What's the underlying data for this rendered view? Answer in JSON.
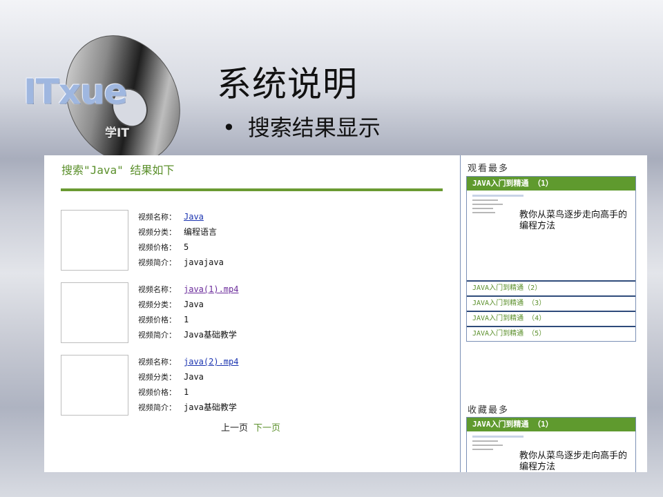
{
  "logo": {
    "text": "ITxue",
    "sub": "学IT"
  },
  "slide": {
    "title": "系统说明",
    "bullet": "搜索结果显示",
    "bullet_dot": "•"
  },
  "search": {
    "heading": "搜索\"Java\" 结果如下"
  },
  "labels": {
    "name": "视频名称：",
    "category": "视频分类：",
    "price": "视频价格：",
    "intro": "视频简介："
  },
  "results": [
    {
      "name": "Java",
      "category": "编程语言",
      "price": "5",
      "intro": "javajava"
    },
    {
      "name": "java(1).mp4",
      "category": "Java",
      "price": "1",
      "intro": "Java基础教学"
    },
    {
      "name": "java(2).mp4",
      "category": "Java",
      "price": "1",
      "intro": "java基础教学"
    }
  ],
  "pager": {
    "prev": "上一页",
    "next": "下一页"
  },
  "sidebar": {
    "most_viewed": {
      "title": "观看最多",
      "featured": "JAVA入门到精通 （1）",
      "featured_desc": "教你从菜鸟逐步走向高手的编程方法",
      "items": [
        "JAVA入门到精通（2）",
        "JAVA入门到精通 （3）",
        "JAVA入门到精通 （4）",
        "JAVA入门到精通 （5）"
      ]
    },
    "most_favorited": {
      "title": "收藏最多",
      "featured": "JAVA入门到精通 （1）",
      "featured_desc": "教你从菜鸟逐步走向高手的编程方法"
    }
  }
}
